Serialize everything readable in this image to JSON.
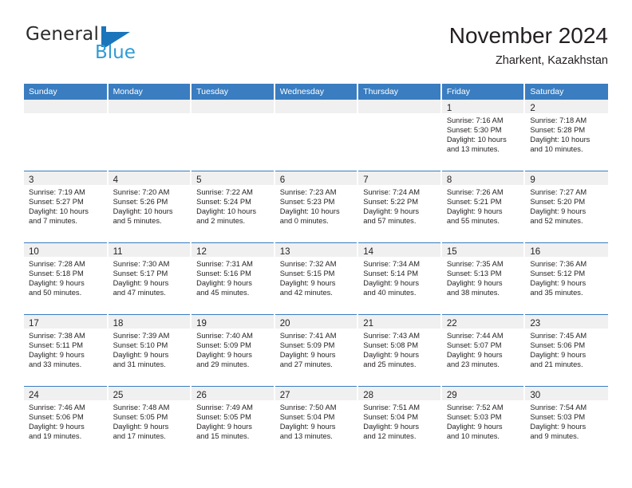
{
  "logo": {
    "word_one": "General",
    "word_two": "Blue",
    "mark_name": "general-blue-triangle-logo",
    "color_primary": "#1b75bb",
    "color_secondary": "#2e9bd6"
  },
  "header": {
    "title": "November 2024",
    "subtitle": "Zharkent, Kazakhstan"
  },
  "theme": {
    "header_blue": "#3a7dc0",
    "daynum_band": "#f0f0f0",
    "text": "#231f20"
  },
  "weekdays": [
    "Sunday",
    "Monday",
    "Tuesday",
    "Wednesday",
    "Thursday",
    "Friday",
    "Saturday"
  ],
  "weeks": [
    [
      {
        "day": "",
        "lines": []
      },
      {
        "day": "",
        "lines": []
      },
      {
        "day": "",
        "lines": []
      },
      {
        "day": "",
        "lines": []
      },
      {
        "day": "",
        "lines": []
      },
      {
        "day": "1",
        "lines": [
          "Sunrise: 7:16 AM",
          "Sunset: 5:30 PM",
          "Daylight: 10 hours",
          "and 13 minutes."
        ]
      },
      {
        "day": "2",
        "lines": [
          "Sunrise: 7:18 AM",
          "Sunset: 5:28 PM",
          "Daylight: 10 hours",
          "and 10 minutes."
        ]
      }
    ],
    [
      {
        "day": "3",
        "lines": [
          "Sunrise: 7:19 AM",
          "Sunset: 5:27 PM",
          "Daylight: 10 hours",
          "and 7 minutes."
        ]
      },
      {
        "day": "4",
        "lines": [
          "Sunrise: 7:20 AM",
          "Sunset: 5:26 PM",
          "Daylight: 10 hours",
          "and 5 minutes."
        ]
      },
      {
        "day": "5",
        "lines": [
          "Sunrise: 7:22 AM",
          "Sunset: 5:24 PM",
          "Daylight: 10 hours",
          "and 2 minutes."
        ]
      },
      {
        "day": "6",
        "lines": [
          "Sunrise: 7:23 AM",
          "Sunset: 5:23 PM",
          "Daylight: 10 hours",
          "and 0 minutes."
        ]
      },
      {
        "day": "7",
        "lines": [
          "Sunrise: 7:24 AM",
          "Sunset: 5:22 PM",
          "Daylight: 9 hours",
          "and 57 minutes."
        ]
      },
      {
        "day": "8",
        "lines": [
          "Sunrise: 7:26 AM",
          "Sunset: 5:21 PM",
          "Daylight: 9 hours",
          "and 55 minutes."
        ]
      },
      {
        "day": "9",
        "lines": [
          "Sunrise: 7:27 AM",
          "Sunset: 5:20 PM",
          "Daylight: 9 hours",
          "and 52 minutes."
        ]
      }
    ],
    [
      {
        "day": "10",
        "lines": [
          "Sunrise: 7:28 AM",
          "Sunset: 5:18 PM",
          "Daylight: 9 hours",
          "and 50 minutes."
        ]
      },
      {
        "day": "11",
        "lines": [
          "Sunrise: 7:30 AM",
          "Sunset: 5:17 PM",
          "Daylight: 9 hours",
          "and 47 minutes."
        ]
      },
      {
        "day": "12",
        "lines": [
          "Sunrise: 7:31 AM",
          "Sunset: 5:16 PM",
          "Daylight: 9 hours",
          "and 45 minutes."
        ]
      },
      {
        "day": "13",
        "lines": [
          "Sunrise: 7:32 AM",
          "Sunset: 5:15 PM",
          "Daylight: 9 hours",
          "and 42 minutes."
        ]
      },
      {
        "day": "14",
        "lines": [
          "Sunrise: 7:34 AM",
          "Sunset: 5:14 PM",
          "Daylight: 9 hours",
          "and 40 minutes."
        ]
      },
      {
        "day": "15",
        "lines": [
          "Sunrise: 7:35 AM",
          "Sunset: 5:13 PM",
          "Daylight: 9 hours",
          "and 38 minutes."
        ]
      },
      {
        "day": "16",
        "lines": [
          "Sunrise: 7:36 AM",
          "Sunset: 5:12 PM",
          "Daylight: 9 hours",
          "and 35 minutes."
        ]
      }
    ],
    [
      {
        "day": "17",
        "lines": [
          "Sunrise: 7:38 AM",
          "Sunset: 5:11 PM",
          "Daylight: 9 hours",
          "and 33 minutes."
        ]
      },
      {
        "day": "18",
        "lines": [
          "Sunrise: 7:39 AM",
          "Sunset: 5:10 PM",
          "Daylight: 9 hours",
          "and 31 minutes."
        ]
      },
      {
        "day": "19",
        "lines": [
          "Sunrise: 7:40 AM",
          "Sunset: 5:09 PM",
          "Daylight: 9 hours",
          "and 29 minutes."
        ]
      },
      {
        "day": "20",
        "lines": [
          "Sunrise: 7:41 AM",
          "Sunset: 5:09 PM",
          "Daylight: 9 hours",
          "and 27 minutes."
        ]
      },
      {
        "day": "21",
        "lines": [
          "Sunrise: 7:43 AM",
          "Sunset: 5:08 PM",
          "Daylight: 9 hours",
          "and 25 minutes."
        ]
      },
      {
        "day": "22",
        "lines": [
          "Sunrise: 7:44 AM",
          "Sunset: 5:07 PM",
          "Daylight: 9 hours",
          "and 23 minutes."
        ]
      },
      {
        "day": "23",
        "lines": [
          "Sunrise: 7:45 AM",
          "Sunset: 5:06 PM",
          "Daylight: 9 hours",
          "and 21 minutes."
        ]
      }
    ],
    [
      {
        "day": "24",
        "lines": [
          "Sunrise: 7:46 AM",
          "Sunset: 5:06 PM",
          "Daylight: 9 hours",
          "and 19 minutes."
        ]
      },
      {
        "day": "25",
        "lines": [
          "Sunrise: 7:48 AM",
          "Sunset: 5:05 PM",
          "Daylight: 9 hours",
          "and 17 minutes."
        ]
      },
      {
        "day": "26",
        "lines": [
          "Sunrise: 7:49 AM",
          "Sunset: 5:05 PM",
          "Daylight: 9 hours",
          "and 15 minutes."
        ]
      },
      {
        "day": "27",
        "lines": [
          "Sunrise: 7:50 AM",
          "Sunset: 5:04 PM",
          "Daylight: 9 hours",
          "and 13 minutes."
        ]
      },
      {
        "day": "28",
        "lines": [
          "Sunrise: 7:51 AM",
          "Sunset: 5:04 PM",
          "Daylight: 9 hours",
          "and 12 minutes."
        ]
      },
      {
        "day": "29",
        "lines": [
          "Sunrise: 7:52 AM",
          "Sunset: 5:03 PM",
          "Daylight: 9 hours",
          "and 10 minutes."
        ]
      },
      {
        "day": "30",
        "lines": [
          "Sunrise: 7:54 AM",
          "Sunset: 5:03 PM",
          "Daylight: 9 hours",
          "and 9 minutes."
        ]
      }
    ]
  ]
}
